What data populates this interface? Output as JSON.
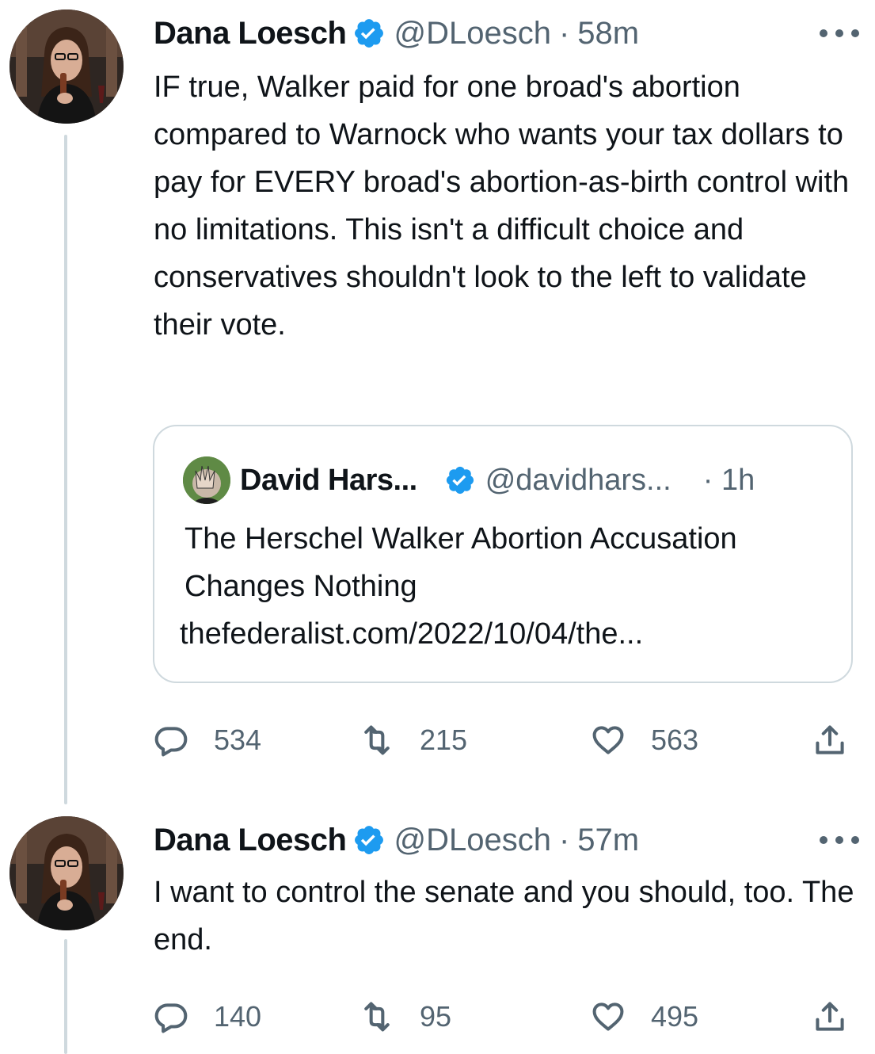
{
  "colors": {
    "text": "#0f1419",
    "secondary": "#536471",
    "verified_badge": "#1d9bf0",
    "border": "#cfd9de"
  },
  "tweets": [
    {
      "author_name": "Dana Loesch",
      "handle": "@DLoesch",
      "separator": "·",
      "time": "58m",
      "text": "IF true, Walker paid for one broad's abortion compared to Warnock who wants your tax dollars to pay for EVERY broad's abortion-as-birth control with no limitations. This isn't a difficult choice and conservatives shouldn't look to the left to validate their vote.",
      "quote": {
        "author_name": "David Hars...",
        "handle": "@davidhars...",
        "time": "· 1h",
        "text": "The Herschel Walker Abortion Accusation Changes Nothing",
        "link": "thefederalist.com/2022/10/04/the..."
      },
      "reply_count": "534",
      "retweet_count": "215",
      "like_count": "563"
    },
    {
      "author_name": "Dana Loesch",
      "handle": "@DLoesch",
      "separator": "·",
      "time": "57m",
      "text": "I want to control the senate and you should, too. The end.",
      "reply_count": "140",
      "retweet_count": "95",
      "like_count": "495"
    }
  ],
  "icons": {
    "reply": "reply-icon",
    "retweet": "retweet-icon",
    "like": "heart-icon",
    "share": "share-icon",
    "verified": "verified-badge-icon",
    "more": "more-options-icon"
  }
}
